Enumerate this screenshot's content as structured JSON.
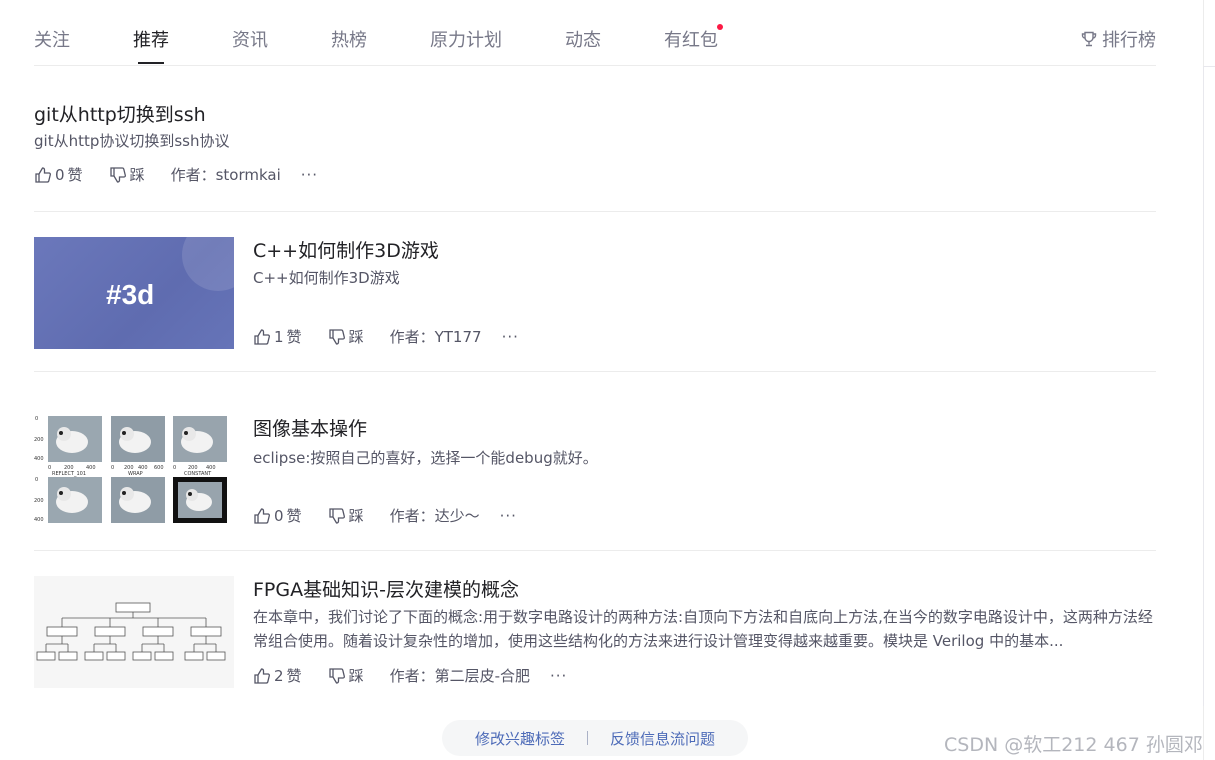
{
  "tabs": [
    "关注",
    "推荐",
    "资讯",
    "热榜",
    "原力计划",
    "动态",
    "有红包"
  ],
  "ranking_label": "排行榜",
  "labels": {
    "like_suffix": "赞",
    "dislike": "踩",
    "author_prefix": "作者：",
    "more": "···"
  },
  "articles": [
    {
      "title": "git从http切换到ssh",
      "desc": "git从http协议切换到ssh协议",
      "likes": "0",
      "author": "stormkai"
    },
    {
      "title": "C++如何制作3D游戏",
      "desc": "C++如何制作3D游戏",
      "likes": "1",
      "author": "YT177",
      "thumb_text": "#3d"
    },
    {
      "title": "图像基本操作",
      "desc": "eclipse:按照自己的喜好，选择一个能debug就好。",
      "likes": "0",
      "author": "达少～",
      "thumb_labels": [
        "REFLECT_101",
        "WRAP",
        "CONSTANT"
      ]
    },
    {
      "title": "FPGA基础知识-层次建模的概念",
      "desc": "在本章中，我们讨论了下面的概念:用于数字电路设计的两种方法:自顶向下方法和自底向上方法,在当今的数字电路设计中，这两种方法经常组合使用。随着设计复杂性的增加，使用这些结构化的方法来进行设计管理变得越来越重要。模块是 Verilog 中的基本...",
      "likes": "2",
      "author": "第二层皮-合肥"
    }
  ],
  "bottom_links": {
    "edit_tags": "修改兴趣标签",
    "feedback": "反馈信息流问题"
  },
  "watermark": "CSDN @软工212 467 孙圆邓",
  "colors": {
    "accent_link": "#4d6bb8",
    "text_main": "#222226",
    "text_muted": "#555666",
    "red_dot": "#fc1944"
  }
}
